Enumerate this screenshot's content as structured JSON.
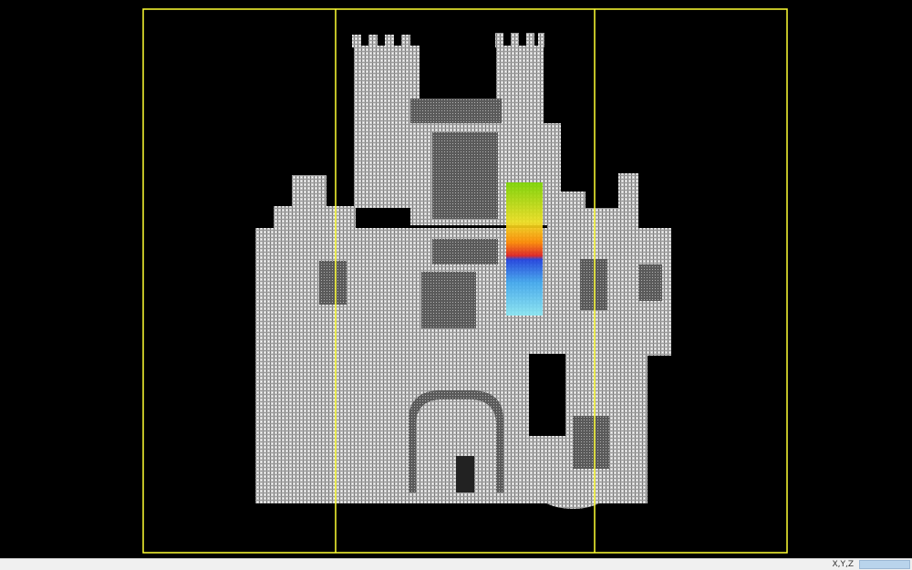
{
  "viewer": {
    "background": "#000000",
    "frame_color": "#ffff33",
    "scan_color": "#e8e8e8",
    "scalar_colormap": [
      "#7dd600",
      "#f0e020",
      "#ff8a00",
      "#e02020",
      "#1e40e0",
      "#40a8f0",
      "#70e0f0"
    ]
  },
  "statusbar": {
    "coord_label": "X,Y,Z",
    "coord_value": ""
  }
}
